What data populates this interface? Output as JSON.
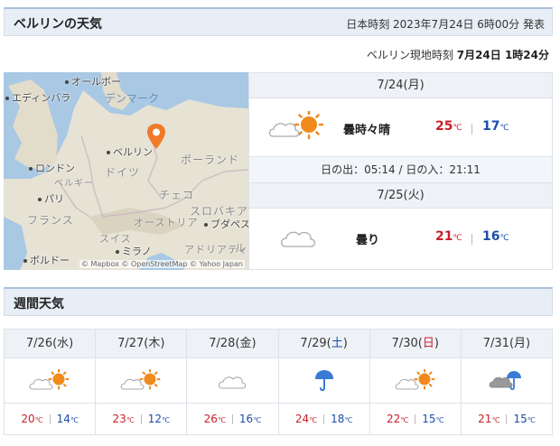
{
  "header": {
    "title": "ベルリンの天気",
    "published": "日本時刻 2023年7月24日 6時00分 発表"
  },
  "localtime": {
    "label": "ベルリン現地時刻",
    "value": "7月24日 1時24分"
  },
  "map": {
    "labels": {
      "oslo": "オールボー",
      "edinburgh": "エディンバラ",
      "denmark": "デンマーク",
      "berlin": "ベルリン",
      "london": "ロンドン",
      "poland": "ポーランド",
      "germany": "ドイツ",
      "belgium": "ベルギー",
      "paris": "パリ",
      "czech": "チェコ",
      "slovakia": "スロバキア",
      "france": "フランス",
      "austria": "オーストリア",
      "budapest": "ブダペス",
      "swiss": "スイス",
      "milan": "ミラノ",
      "bordeaux": "ボルドー",
      "adriatic": "アドリアティ",
      "ru": "ル"
    },
    "credit": "© Mapbox © OpenStreetMap © Yahoo Japan"
  },
  "today": {
    "date": "7/24(月)",
    "weather": "曇時々晴",
    "icon": "cloud-sun-icon",
    "high": "25",
    "low": "17",
    "unit": "℃"
  },
  "sun": {
    "text": "日の出：05:14 / 日の入：21:11"
  },
  "tomorrow": {
    "date": "7/25(火)",
    "weather": "曇り",
    "icon": "cloud-icon",
    "high": "21",
    "low": "16",
    "unit": "℃"
  },
  "weekly": {
    "title": "週間天気",
    "days": [
      {
        "date": "7/26(水)",
        "icon": "cloud-sun-icon",
        "high": "20",
        "low": "14"
      },
      {
        "date": "7/27(木)",
        "icon": "cloud-sun-icon",
        "high": "23",
        "low": "12"
      },
      {
        "date": "7/28(金)",
        "icon": "cloud-icon",
        "high": "26",
        "low": "16"
      },
      {
        "date": "7/29(",
        "dow": "土",
        "tail": ")",
        "icon": "umbrella-icon",
        "high": "24",
        "low": "18"
      },
      {
        "date": "7/30(",
        "dow": "日",
        "tail": ")",
        "icon": "cloud-sun-icon",
        "high": "22",
        "low": "15"
      },
      {
        "date": "7/31(月)",
        "icon": "cloud-umbrella-icon",
        "high": "21",
        "low": "15"
      }
    ],
    "unit": "℃"
  },
  "colors": {
    "high": "#c8202a",
    "low": "#1a4ea8",
    "header_bg": "#e8eef6",
    "sun": "#f08a1c",
    "pin": "#f07a2a"
  }
}
